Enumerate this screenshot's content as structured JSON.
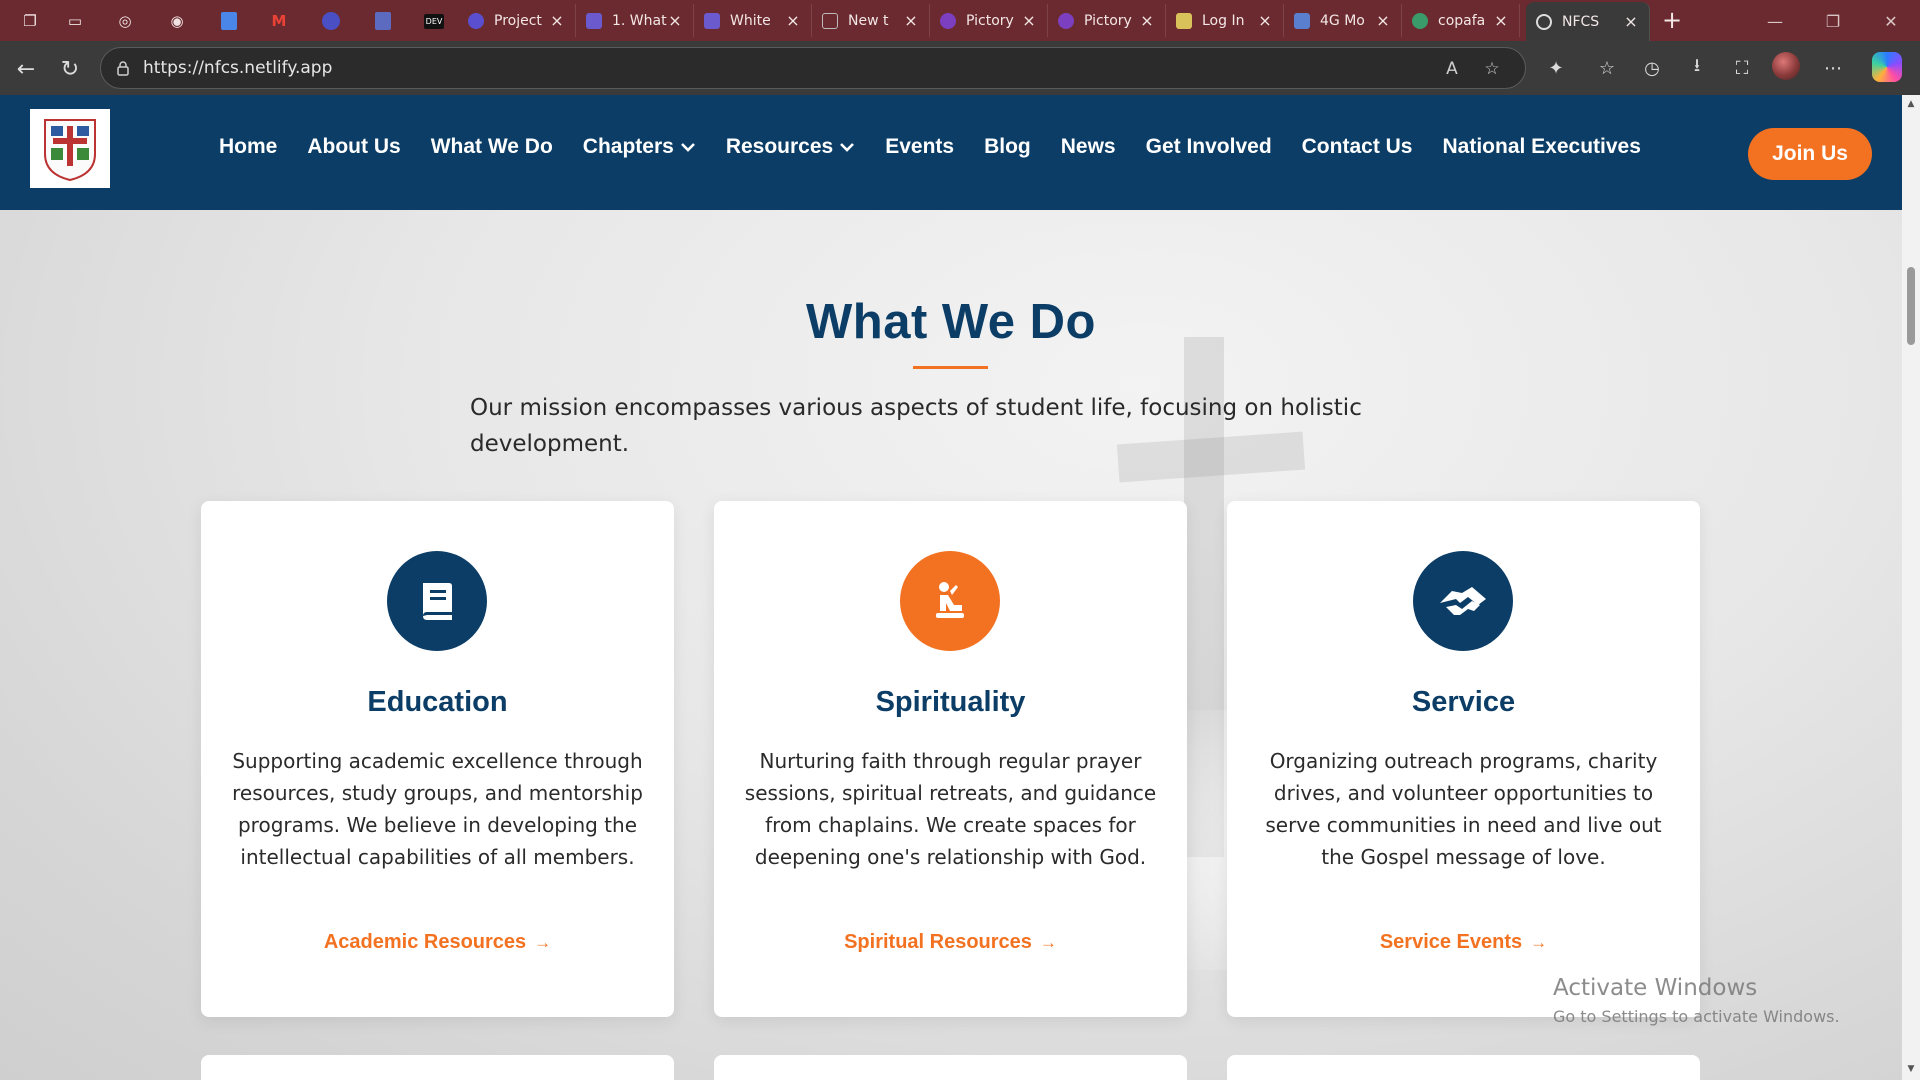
{
  "browser": {
    "tabs": [
      {
        "label": "Project",
        "favicon_color": "#5a4fcf"
      },
      {
        "label": "1. What",
        "favicon_color": "#6a5acd"
      },
      {
        "label": "White",
        "favicon_color": "#6a5acd"
      },
      {
        "label": "New t",
        "favicon_color": "#8a8a8a"
      },
      {
        "label": "Pictory",
        "favicon_color": "#7b3fbf"
      },
      {
        "label": "Pictory",
        "favicon_color": "#7b3fbf"
      },
      {
        "label": "Log In",
        "favicon_color": "#d9c25a"
      },
      {
        "label": "4G Mo",
        "favicon_color": "#5a7fcf"
      },
      {
        "label": "copafa",
        "favicon_color": "#3a9a6a"
      },
      {
        "label": "NFCS",
        "favicon_color": "#cccccc",
        "active": true
      }
    ],
    "pinned_labels": [
      "DEV"
    ],
    "url": "https://nfcs.netlify.app"
  },
  "site": {
    "nav": {
      "home": "Home",
      "about": "About Us",
      "what_we_do": "What We Do",
      "chapters": "Chapters",
      "resources": "Resources",
      "events": "Events",
      "blog": "Blog",
      "news": "News",
      "get_involved": "Get Involved",
      "contact": "Contact Us",
      "executives": "National Executives"
    },
    "join_label": "Join Us",
    "colors": {
      "primary": "#0b3d66",
      "accent": "#f37221"
    }
  },
  "section": {
    "title": "What We Do",
    "description": "Our mission encompasses various aspects of student life, focusing on holistic development.",
    "cards": [
      {
        "icon": "book-icon",
        "title": "Education",
        "text": "Supporting academic excellence through resources, study groups, and mentorship programs. We believe in developing the intellectual capabilities of all members.",
        "link": "Academic Resources"
      },
      {
        "icon": "praying-icon",
        "title": "Spirituality",
        "text": "Nurturing faith through regular prayer sessions, spiritual retreats, and guidance from chaplains. We create spaces for deepening one's relationship with God.",
        "link": "Spiritual Resources"
      },
      {
        "icon": "handshake-icon",
        "title": "Service",
        "text": "Organizing outreach programs, charity drives, and volunteer opportunities to serve communities in need and live out the Gospel message of love.",
        "link": "Service Events"
      }
    ]
  },
  "watermark": {
    "line1": "Activate Windows",
    "line2": "Go to Settings to activate Windows."
  }
}
